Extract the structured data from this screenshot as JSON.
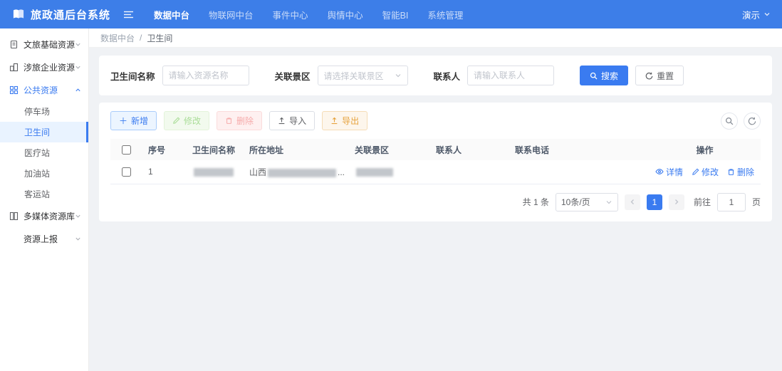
{
  "colors": {
    "header_bg": "#3d7ee8",
    "accent_blue": "#3a7bf0",
    "active_item_bg": "#e9f3ff",
    "export_orange": "#e6a23c",
    "disabled_green": "#aadd98",
    "disabled_red": "#f6abab",
    "page_bg": "#f0f2f5"
  },
  "header": {
    "app_title": "旅政通后台系统",
    "nav": [
      {
        "label": "数据中台",
        "active": true
      },
      {
        "label": "物联网中台",
        "active": false
      },
      {
        "label": "事件中心",
        "active": false
      },
      {
        "label": "舆情中心",
        "active": false
      },
      {
        "label": "智能BI",
        "active": false
      },
      {
        "label": "系统管理",
        "active": false
      }
    ],
    "user_label": "演示"
  },
  "sidebar": {
    "groups": [
      {
        "label": "文旅基础资源",
        "icon": "document-icon",
        "expanded": false
      },
      {
        "label": "涉旅企业资源",
        "icon": "building-icon",
        "expanded": false
      },
      {
        "label": "公共资源",
        "icon": "grid-icon",
        "expanded": true,
        "active": true,
        "children": [
          {
            "label": "停车场",
            "active": false
          },
          {
            "label": "卫生间",
            "active": true
          },
          {
            "label": "医疗站",
            "active": false
          },
          {
            "label": "加油站",
            "active": false
          },
          {
            "label": "客运站",
            "active": false
          }
        ]
      },
      {
        "label": "多媒体资源库",
        "icon": "media-icon",
        "expanded": false
      },
      {
        "label": "资源上报",
        "icon": null,
        "expanded": false
      }
    ]
  },
  "breadcrumb": {
    "root": "数据中台",
    "separator": "/",
    "current": "卫生间"
  },
  "search": {
    "name_label": "卫生间名称",
    "name_placeholder": "请输入资源名称",
    "scenic_label": "关联景区",
    "scenic_placeholder": "请选择关联景区",
    "contact_label": "联系人",
    "contact_placeholder": "请输入联系人",
    "search_button": "搜索",
    "reset_button": "重置"
  },
  "toolbar": {
    "add": "新增",
    "edit": "修改",
    "delete": "删除",
    "import": "导入",
    "export": "导出"
  },
  "table": {
    "columns": [
      "序号",
      "卫生间名称",
      "所在地址",
      "关联景区",
      "联系人",
      "联系电话",
      "操作"
    ],
    "rows": [
      {
        "seq": "1",
        "name_redacted": true,
        "address_prefix": "山西",
        "address_redacted": true,
        "address_ellipsis": "...",
        "scenic_redacted": true,
        "contact": "",
        "phone": "",
        "actions": {
          "detail": "详情",
          "edit": "修改",
          "delete": "删除"
        }
      }
    ]
  },
  "pagination": {
    "total": "共 1 条",
    "page_size": "10条/页",
    "current_page": "1",
    "goto_label": "前往",
    "goto_value": "1",
    "page_unit": "页"
  }
}
